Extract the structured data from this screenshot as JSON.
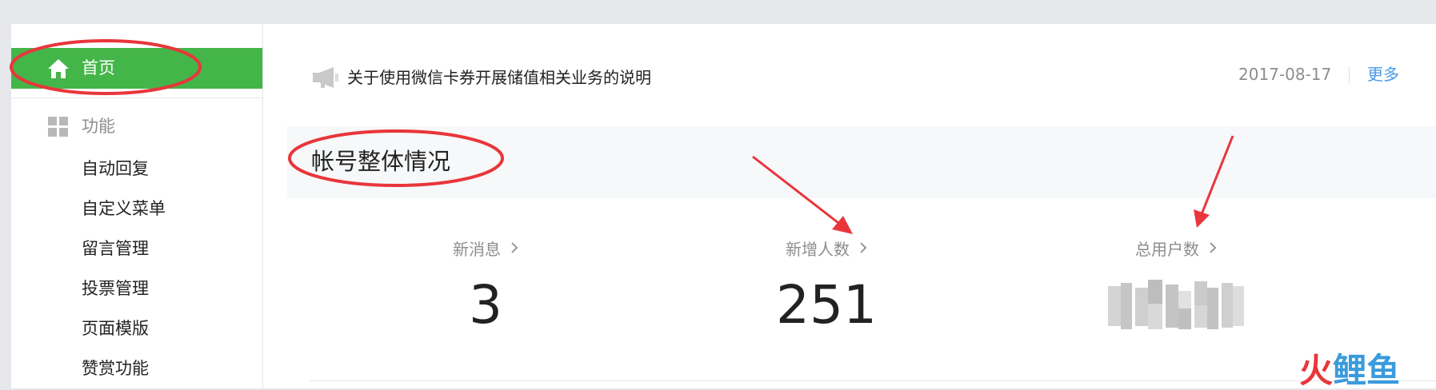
{
  "sidebar": {
    "home_label": "首页",
    "group_label": "功能",
    "items": [
      {
        "label": "自动回复"
      },
      {
        "label": "自定义菜单"
      },
      {
        "label": "留言管理"
      },
      {
        "label": "投票管理"
      },
      {
        "label": "页面模版"
      },
      {
        "label": "赞赏功能"
      }
    ],
    "home_icon": "home-icon",
    "group_icon": "grid-icon",
    "active_color": "#44b549"
  },
  "notice": {
    "icon": "megaphone-icon",
    "text": "关于使用微信卡券开展储值相关业务的说明",
    "date": "2017-08-17",
    "more_label": "更多"
  },
  "overview": {
    "title": "帐号整体情况",
    "stats": [
      {
        "label": "新消息",
        "value": "3"
      },
      {
        "label": "新增人数",
        "value": "251"
      },
      {
        "label": "总用户数",
        "value": "",
        "blurred": true
      }
    ]
  },
  "annotations": {
    "highlight_color": "#e8363b",
    "circles": [
      "home-item",
      "overview-title"
    ],
    "arrows": [
      "stat-new-users",
      "stat-total-users"
    ]
  },
  "watermark": {
    "chars": [
      "火",
      "鲤",
      "鱼"
    ],
    "colors": [
      "#e8363b",
      "#3a9bdc",
      "#3a9bdc"
    ]
  }
}
